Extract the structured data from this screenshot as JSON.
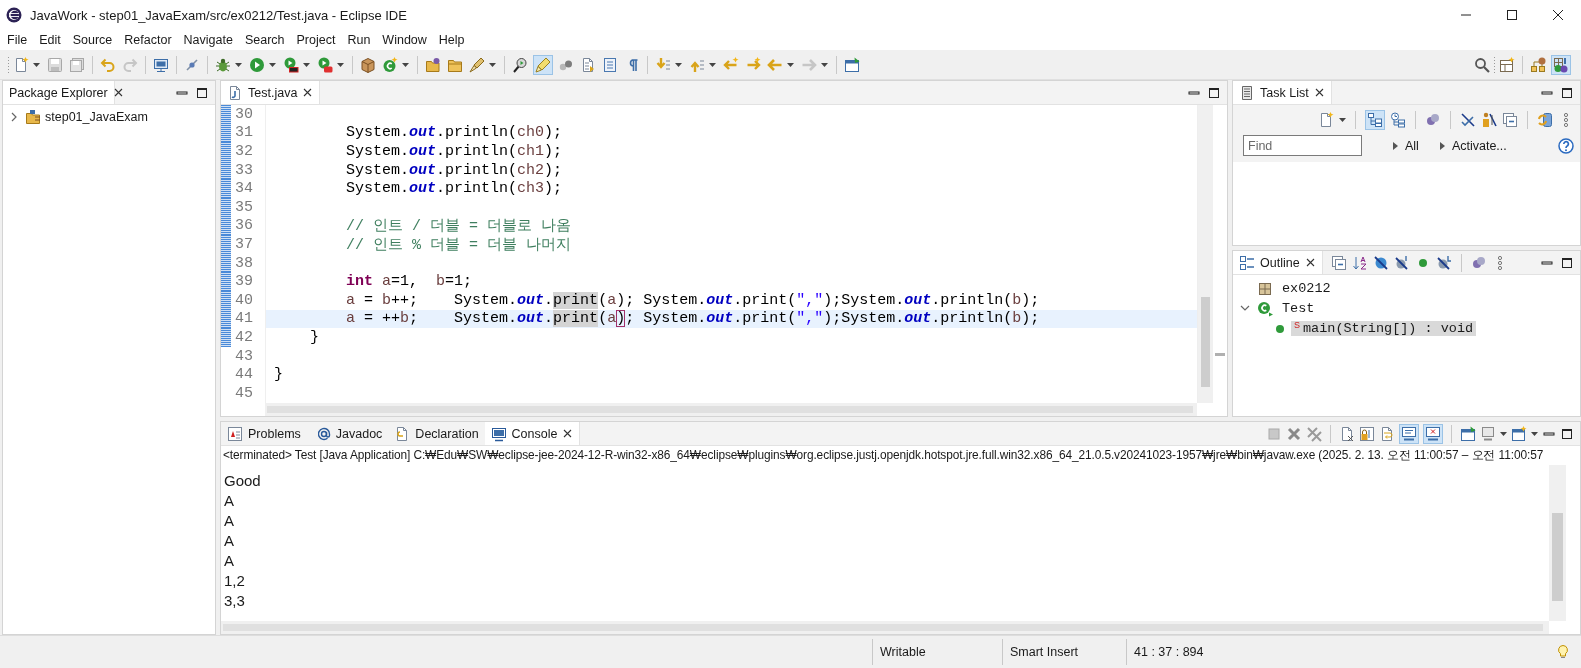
{
  "window": {
    "title": "JavaWork - step01_JavaExam/src/ex0212/Test.java - Eclipse IDE"
  },
  "menu": [
    "File",
    "Edit",
    "Source",
    "Refactor",
    "Navigate",
    "Search",
    "Project",
    "Run",
    "Window",
    "Help"
  ],
  "toolbar": {
    "mark_occurrences": {
      "on": true
    },
    "java_perspective": {
      "on": true
    }
  },
  "package_explorer": {
    "tab": {
      "label": "Package Explorer",
      "selected": true
    },
    "items": [
      {
        "label": "step01_JavaExam",
        "expanded": false
      }
    ]
  },
  "editor": {
    "tab": {
      "label": "Test.java",
      "selected": true
    },
    "lines": [
      {
        "number": "30",
        "changed": true,
        "current": false
      },
      {
        "number": "31",
        "changed": true,
        "current": false,
        "tokens": [
          {
            "kind": "plain",
            "text": "        System."
          },
          {
            "kind": "field",
            "text": "out"
          },
          {
            "kind": "plain",
            "text": ".println("
          },
          {
            "kind": "var",
            "text": "ch0"
          },
          {
            "kind": "plain",
            "text": ");"
          }
        ]
      },
      {
        "number": "32",
        "changed": true,
        "current": false,
        "tokens": [
          {
            "kind": "plain",
            "text": "        System."
          },
          {
            "kind": "field",
            "text": "out"
          },
          {
            "kind": "plain",
            "text": ".println("
          },
          {
            "kind": "var",
            "text": "ch1"
          },
          {
            "kind": "plain",
            "text": ");"
          }
        ]
      },
      {
        "number": "33",
        "changed": true,
        "current": false,
        "tokens": [
          {
            "kind": "plain",
            "text": "        System."
          },
          {
            "kind": "field",
            "text": "out"
          },
          {
            "kind": "plain",
            "text": ".println("
          },
          {
            "kind": "var",
            "text": "ch2"
          },
          {
            "kind": "plain",
            "text": ");"
          }
        ]
      },
      {
        "number": "34",
        "changed": true,
        "current": false,
        "tokens": [
          {
            "kind": "plain",
            "text": "        System."
          },
          {
            "kind": "field",
            "text": "out"
          },
          {
            "kind": "plain",
            "text": ".println("
          },
          {
            "kind": "var",
            "text": "ch3"
          },
          {
            "kind": "plain",
            "text": ");"
          }
        ]
      },
      {
        "number": "35",
        "changed": true,
        "current": false
      },
      {
        "number": "36",
        "changed": true,
        "current": false,
        "tokens": [
          {
            "kind": "comment",
            "text": "        // 인트 / 더블 = 더블로 나옴"
          }
        ]
      },
      {
        "number": "37",
        "changed": true,
        "current": false,
        "tokens": [
          {
            "kind": "comment",
            "text": "        // 인트 % 더블 = 더블 나머지"
          }
        ]
      },
      {
        "number": "38",
        "changed": true,
        "current": false
      },
      {
        "number": "39",
        "changed": true,
        "current": false,
        "tokens": [
          {
            "kind": "keyword",
            "text": "        int"
          },
          {
            "kind": "var",
            "text": " a"
          },
          {
            "kind": "plain",
            "text": "=1,  "
          },
          {
            "kind": "var",
            "text": "b"
          },
          {
            "kind": "plain",
            "text": "=1;"
          }
        ]
      },
      {
        "number": "40",
        "changed": true,
        "current": false,
        "tokens": [
          {
            "kind": "var",
            "text": "        a"
          },
          {
            "kind": "plain",
            "text": " = "
          },
          {
            "kind": "var",
            "text": "b"
          },
          {
            "kind": "plain",
            "text": "++;    System."
          },
          {
            "kind": "field",
            "text": "out"
          },
          {
            "kind": "plain",
            "text": "."
          },
          {
            "kind": "occurrence",
            "text": "print"
          },
          {
            "kind": "plain",
            "text": "("
          },
          {
            "kind": "var",
            "text": "a"
          },
          {
            "kind": "plain",
            "text": "); System."
          },
          {
            "kind": "field",
            "text": "out"
          },
          {
            "kind": "plain",
            "text": ".print("
          },
          {
            "kind": "string",
            "text": "\",\""
          },
          {
            "kind": "plain",
            "text": ");System."
          },
          {
            "kind": "field",
            "text": "out"
          },
          {
            "kind": "plain",
            "text": ".println("
          },
          {
            "kind": "var",
            "text": "b"
          },
          {
            "kind": "plain",
            "text": ");"
          }
        ]
      },
      {
        "number": "41",
        "changed": true,
        "current": true,
        "tokens": [
          {
            "kind": "var",
            "text": "        a"
          },
          {
            "kind": "plain",
            "text": " = ++"
          },
          {
            "kind": "var",
            "text": "b"
          },
          {
            "kind": "plain",
            "text": ";    System."
          },
          {
            "kind": "field",
            "text": "out"
          },
          {
            "kind": "plain",
            "text": "."
          },
          {
            "kind": "occurrence",
            "text": "print"
          },
          {
            "kind": "plain",
            "text": "("
          },
          {
            "kind": "var",
            "text": "a"
          },
          {
            "kind": "bracket",
            "text": ")"
          },
          {
            "kind": "plain",
            "text": "; System."
          },
          {
            "kind": "field",
            "text": "out"
          },
          {
            "kind": "plain",
            "text": ".print("
          },
          {
            "kind": "string",
            "text": "\",\""
          },
          {
            "kind": "plain",
            "text": ");System."
          },
          {
            "kind": "field",
            "text": "out"
          },
          {
            "kind": "plain",
            "text": ".println("
          },
          {
            "kind": "var",
            "text": "b"
          },
          {
            "kind": "plain",
            "text": ");"
          }
        ]
      },
      {
        "number": "42",
        "changed": true,
        "current": false,
        "tokens": [
          {
            "kind": "plain",
            "text": "    }"
          }
        ]
      },
      {
        "number": "43",
        "changed": false,
        "current": false
      },
      {
        "number": "44",
        "changed": false,
        "current": false,
        "tokens": [
          {
            "kind": "plain",
            "text": "}"
          }
        ]
      },
      {
        "number": "45",
        "changed": false,
        "current": false
      }
    ]
  },
  "task_list": {
    "tab": {
      "label": "Task List",
      "selected": true
    },
    "categorized_toggle": {
      "on": true
    },
    "find": {
      "placeholder": "Find"
    },
    "filters": [
      "All",
      "Activate..."
    ]
  },
  "outline": {
    "tab": {
      "label": "Outline",
      "selected": true
    },
    "items": [
      {
        "kind": "package",
        "label": "ex0212",
        "selected": false
      },
      {
        "kind": "class",
        "label": "Test",
        "selected": false,
        "expanded": true,
        "children": [
          {
            "kind": "method",
            "label": "main(String[]) : void",
            "modifier": "S",
            "selected": true
          }
        ]
      }
    ]
  },
  "console": {
    "tabs": [
      {
        "label": "Problems",
        "selected": false
      },
      {
        "label": "Javadoc",
        "selected": false
      },
      {
        "label": "Declaration",
        "selected": false
      },
      {
        "label": "Console",
        "selected": true
      }
    ],
    "stdout_toggle": {
      "on": true
    },
    "stderr_toggle": {
      "on": true
    },
    "status": "<terminated> Test [Java Application] C:₩Edu₩SW₩eclipse-jee-2024-12-R-win32-x86_64₩eclipse₩plugins₩org.eclipse.justj.openjdk.hotspot.jre.full.win32.x86_64_21.0.5.v20241023-1957₩jre₩bin₩javaw.exe  (2025. 2. 13. 오전 11:00:57 – 오전 11:00:57",
    "output": [
      "Good",
      "A",
      "A",
      "A",
      "A",
      "1,2",
      "3,3"
    ]
  },
  "status_bar": [
    "Writable",
    "Smart Insert",
    "41 : 37 : 894"
  ]
}
